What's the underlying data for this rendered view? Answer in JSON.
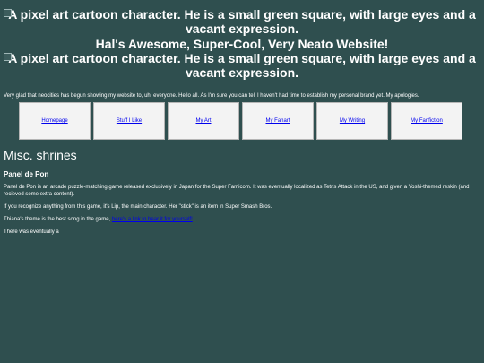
{
  "header": {
    "image_alt_1": "A pixel art cartoon character. He is a small green square, with large eyes and a vacant expression.",
    "site_title": "Hal's Awesome, Super-Cool, Very Neato Website!",
    "image_alt_2": "A pixel art cartoon character. He is a small green square, with large eyes and a vacant expression."
  },
  "intro": "Very glad that neocities has begun showing my website to, uh, everyone. Hello all. As I'm sure you can tell I haven't had time to establish my personal brand yet. My apologies.",
  "nav": {
    "items": [
      {
        "label": "Homepage"
      },
      {
        "label": "Stuff I Like"
      },
      {
        "label": "My Art"
      },
      {
        "label": "My Fanart"
      },
      {
        "label": "My Writing"
      },
      {
        "label": "My Fanfiction"
      }
    ]
  },
  "main": {
    "section_title": "Misc. shrines",
    "subsection_title": "Panel de Pon",
    "paragraph_1": "Panel de Pon is an arcade puzzle-matching game released exclusively in Japan for the Super Famicom. It was eventually localized as Tetris Attack in the US, and given a Yoshi-themed reskin (and recieved some extra content).",
    "paragraph_2": "If you recognize anything from this game, it's Lip, the main character. Her \"stick\" is an item in Super Smash Bros.",
    "paragraph_3_text": "Thiana's theme is the best song in the game, ",
    "paragraph_3_link": "here's a link to hear it for yourself!",
    "paragraph_4": "There was eventually a"
  },
  "colors": {
    "background": "#2f4f4f",
    "text": "#ffffff",
    "link": "#0000ee",
    "nav_box": "#f3f3f3"
  },
  "icons": {
    "broken_image": "broken-image-icon"
  }
}
